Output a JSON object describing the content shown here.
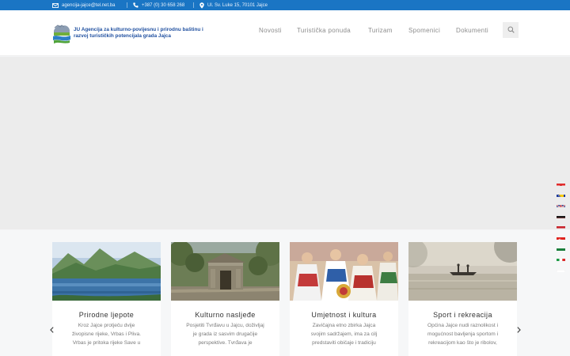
{
  "topbar": {
    "email": "agencija-jajce@tel.net.ba",
    "phone": "+387 (0) 30 658 268",
    "address": "Ul. Sv. Luke 15, 70101 Jajce"
  },
  "logo": {
    "line1": "JU Agencija za kulturno-povijesnu i prirodnu baštinu i",
    "line2": "razvoj turističkih potencijala grada Jajca"
  },
  "nav": [
    "Novosti",
    "Turistička ponuda",
    "Turizam",
    "Spomenici",
    "Dokumenti"
  ],
  "cards": [
    {
      "title": "Prirodne ljepote",
      "text": [
        "Kroz Jajce protječu dvije",
        "živopisne rijeke, Vrbas i Pliva.",
        "Vrbas je pritoka rijeke Save u"
      ]
    },
    {
      "title": "Kulturno nasljeđe",
      "text": [
        "Posjetiti Tvrđavu u Jajcu, doživljaj",
        "je grada iz sasvim drugačije",
        "perspektive. Tvrđava je"
      ]
    },
    {
      "title": "Umjetnost i kultura",
      "text": [
        "Zavičajna etno zbirka Jajca",
        "svojim sadržajem, ima za cilj",
        "predstaviti običaje i tradiciju"
      ]
    },
    {
      "title": "Sport i rekreacija",
      "text": [
        "Općina Jajce nudi raznolikost i",
        "mogućnost bavljenja sportom i",
        "rekreacijom kao što je ribolov,"
      ]
    }
  ],
  "colors": {
    "topbar": "#1a75c4",
    "logo_text": "#2050a0",
    "nav_text": "#8d8d8d"
  },
  "icons": {
    "email": "envelope-icon",
    "phone": "phone-icon",
    "address": "map-pin-icon",
    "search": "search-icon",
    "prev": "chevron-left-icon",
    "next": "chevron-right-icon"
  },
  "languages": [
    "hr",
    "ba",
    "gb",
    "de",
    "nl",
    "tr",
    "sa",
    "it",
    "pl"
  ]
}
